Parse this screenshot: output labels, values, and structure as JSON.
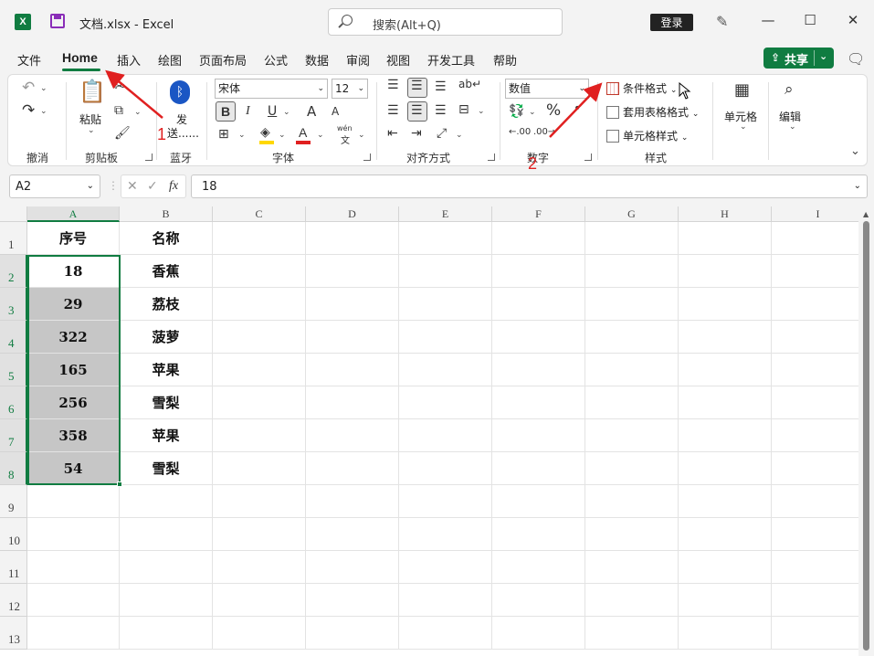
{
  "titlebar": {
    "app_icon": "X",
    "title": "文档.xlsx  -  Excel",
    "search_placeholder": "搜索(Alt+Q)",
    "login_label": "登录",
    "minimize": "—",
    "maximize": "☐",
    "close": "✕"
  },
  "menu": {
    "tabs": [
      "文件",
      "Home",
      "插入",
      "绘图",
      "页面布局",
      "公式",
      "数据",
      "审阅",
      "视图",
      "开发工具",
      "帮助"
    ],
    "share_label": "共享",
    "share_icon": "share-icon"
  },
  "ribbon": {
    "groups": [
      "撤消",
      "剪贴板",
      "蓝牙",
      "字体",
      "对齐方式",
      "数字",
      "样式"
    ],
    "paste_label": "粘贴",
    "bluetooth_label_1": "发",
    "bluetooth_label_2": "送......",
    "font_name": "宋体",
    "font_size": "12",
    "bold": "B",
    "italic": "I",
    "underline": "U",
    "grow_font": "A",
    "shrink_font": "A",
    "font_color": "A",
    "phonetic_top": "wén",
    "phonetic_bottom": "文",
    "number_format": "数值",
    "percent": "%",
    "conditional_format": "条件格式",
    "table_format": "套用表格格式",
    "cell_styles": "单元格样式",
    "cells_label": "单元格",
    "edit_label": "编辑",
    "highlight_color": "#ffd800",
    "font_color_value": "#e02020"
  },
  "formula_bar": {
    "name_box": "A2",
    "fx": "fx",
    "value": "18"
  },
  "sheet": {
    "columns": [
      "A",
      "B",
      "C",
      "D",
      "E",
      "F",
      "G",
      "H",
      "I"
    ],
    "rows": [
      "1",
      "2",
      "3",
      "4",
      "5",
      "6",
      "7",
      "8",
      "9",
      "10",
      "11",
      "12",
      "13"
    ],
    "header": [
      "序号",
      "名称"
    ],
    "data": [
      [
        "18",
        "香蕉"
      ],
      [
        "29",
        "荔枝"
      ],
      [
        "322",
        "菠萝"
      ],
      [
        "165",
        "苹果"
      ],
      [
        "256",
        "雪梨"
      ],
      [
        "358",
        "苹果"
      ],
      [
        "54",
        "雪梨"
      ]
    ],
    "selection": "A2:A8",
    "accent": "#107c41"
  },
  "annotations": {
    "step1": "1",
    "step2": "2",
    "color": "#e02020"
  }
}
